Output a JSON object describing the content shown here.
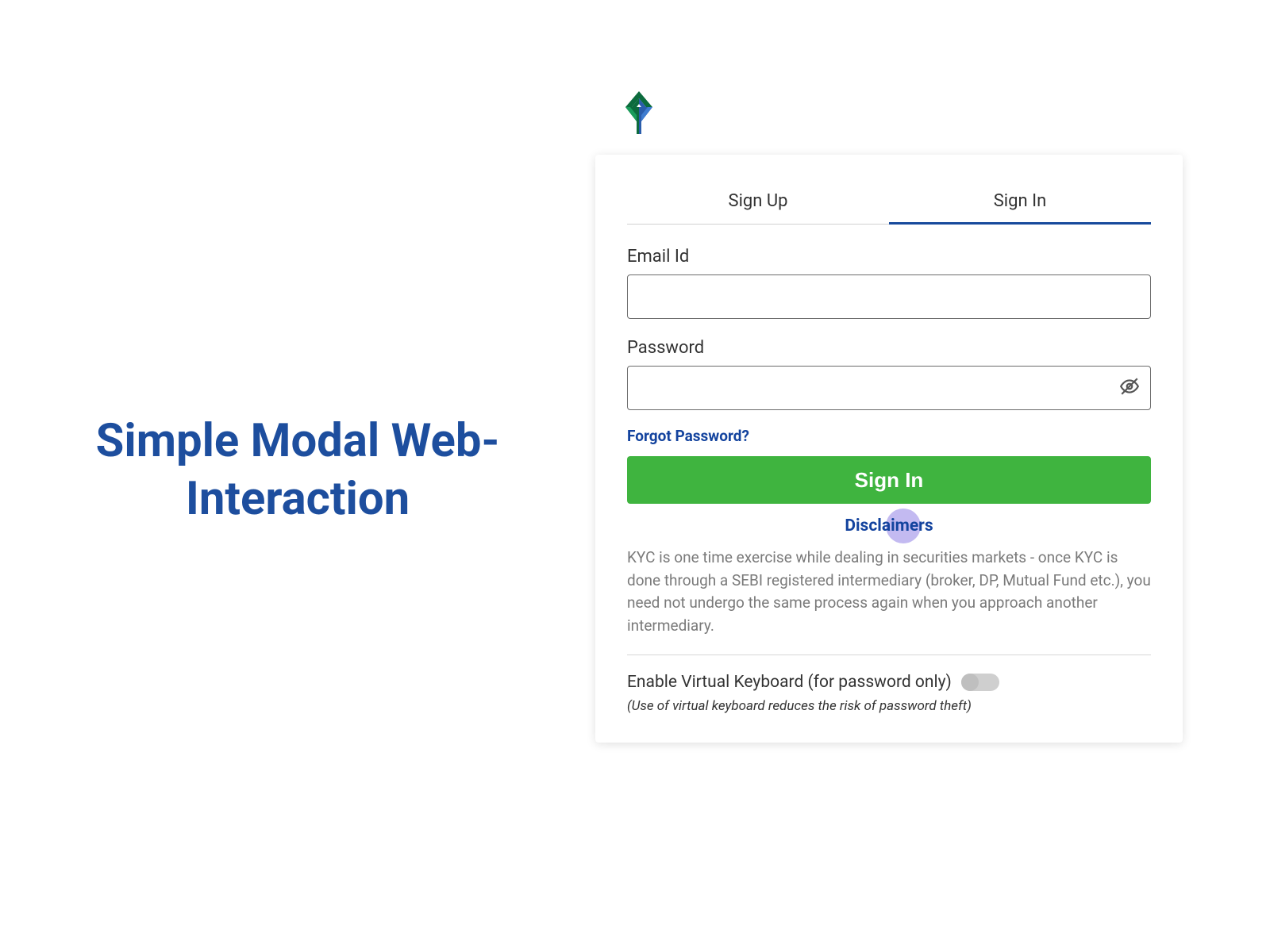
{
  "side_text": "Simple Modal Web-Interaction",
  "tabs": {
    "signup": "Sign Up",
    "signin": "Sign In",
    "active": "signin"
  },
  "form": {
    "email_label": "Email Id",
    "email_value": "",
    "password_label": "Password",
    "password_value": "",
    "forgot": "Forgot Password?",
    "submit": "Sign In"
  },
  "disclaimers": {
    "link": "Disclaimers",
    "body": "KYC is one time exercise while dealing in securities markets - once KYC is done through a SEBI registered intermediary (broker, DP, Mutual Fund etc.), you need not undergo the same process again when you approach another intermediary."
  },
  "virtual_keyboard": {
    "label": "Enable Virtual Keyboard (for password only)",
    "enabled": false,
    "note": "(Use of virtual keyboard reduces the risk of password theft)"
  }
}
